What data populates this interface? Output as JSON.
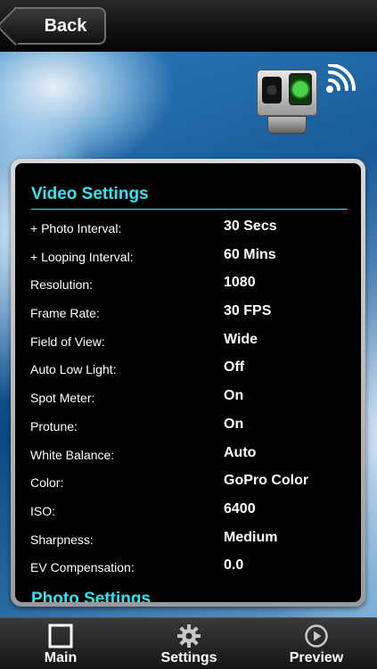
{
  "header": {
    "back_label": "Back"
  },
  "video_settings": {
    "title": "Video Settings",
    "rows": [
      {
        "label": "+ Photo Interval:",
        "value": "30 Secs"
      },
      {
        "label": "+ Looping Interval:",
        "value": "60 Mins"
      },
      {
        "label": "Resolution:",
        "value": "1080"
      },
      {
        "label": "Frame Rate:",
        "value": "30 FPS"
      },
      {
        "label": "Field of View:",
        "value": "Wide"
      },
      {
        "label": "Auto Low Light:",
        "value": "Off"
      },
      {
        "label": "Spot Meter:",
        "value": "On"
      },
      {
        "label": "Protune:",
        "value": "On"
      },
      {
        "label": "White Balance:",
        "value": "Auto"
      },
      {
        "label": "Color:",
        "value": "GoPro Color"
      },
      {
        "label": "ISO:",
        "value": "6400"
      },
      {
        "label": "Sharpness:",
        "value": "Medium"
      },
      {
        "label": "EV Compensation:",
        "value": " 0.0"
      }
    ]
  },
  "photo_settings": {
    "title": "Photo Settings"
  },
  "tabs": {
    "main": {
      "label": "Main",
      "icon": "square-icon"
    },
    "settings": {
      "label": "Settings",
      "icon": "gear-icon"
    },
    "preview": {
      "label": "Preview",
      "icon": "play-circle-icon"
    }
  },
  "colors": {
    "accent": "#35e3ee"
  }
}
